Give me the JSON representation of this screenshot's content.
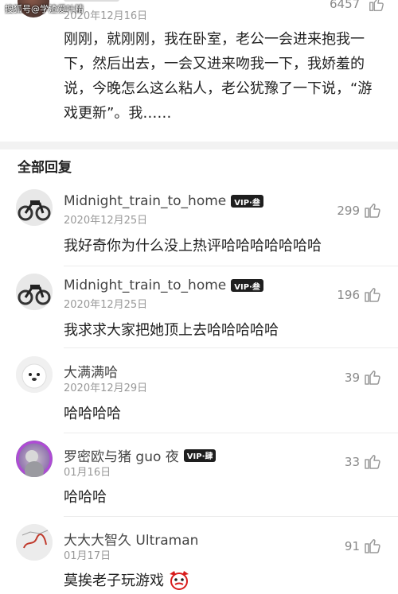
{
  "watermark": "搜狐号@学渣爱叶精",
  "top_post": {
    "date": "2020年12月16日",
    "likes": "6457",
    "body": "刚刚，就刚刚，我在卧室，老公一会进来抱我一下，然后出去，一会又进来吻我一下，我娇羞的说，今晚怎么这么粘人，老公犹豫了一下说，“游戏更新”。我……"
  },
  "section_title": "全部回复",
  "comments": [
    {
      "name": "Midnight_train_to_home",
      "vip": "VIP·叁",
      "date": "2020年12月25日",
      "likes": "299",
      "text": "我好奇你为什么没上热评哈哈哈哈哈哈哈"
    },
    {
      "name": "Midnight_train_to_home",
      "vip": "VIP·叁",
      "date": "2020年12月25日",
      "likes": "196",
      "text": "我求求大家把她顶上去哈哈哈哈哈"
    },
    {
      "name": "大满满哈",
      "date": "2020年12月29日",
      "likes": "39",
      "text": "哈哈哈哈"
    },
    {
      "name": "罗密欧与猪 guo 夜",
      "vip": "VIP·肆",
      "date": "01月16日",
      "likes": "33",
      "text": "哈哈哈"
    },
    {
      "name": "大大大智久 Ultraman",
      "date": "01月17日",
      "likes": "91",
      "text": "莫挨老子玩游戏"
    }
  ],
  "icons": {
    "like": "thumbs-up-icon",
    "emoji": "angry-face-emoji"
  },
  "colors": {
    "name": "#444444",
    "meta": "#999999",
    "vip_badge": "#1e1e1e",
    "band": "#f2f2f2"
  }
}
